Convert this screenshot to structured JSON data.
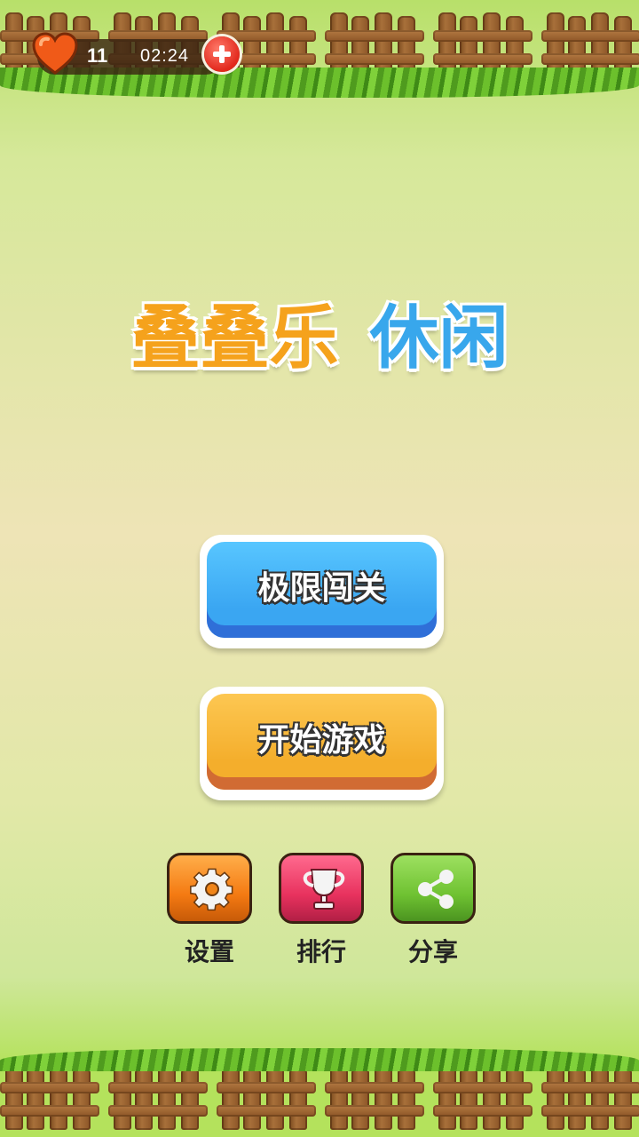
{
  "hud": {
    "lives": "11",
    "timer": "02:24"
  },
  "title": {
    "main": "叠叠乐",
    "sub": "休闲"
  },
  "buttons": {
    "challenge": "极限闯关",
    "start": "开始游戏",
    "settings": "设置",
    "rank": "排行",
    "share": "分享"
  },
  "icons": {
    "lives": "heart-icon",
    "add_lives": "plus-icon",
    "settings": "gear-icon",
    "rank": "trophy-icon",
    "share": "share-icon"
  },
  "colors": {
    "challenge_button": "#3aa6f2",
    "start_button": "#f4ae2c",
    "settings_button": "#f47a12",
    "rank_button": "#e8325e",
    "share_button": "#6fc232",
    "title_main": "#f5a21c",
    "title_sub": "#38a7ec"
  }
}
